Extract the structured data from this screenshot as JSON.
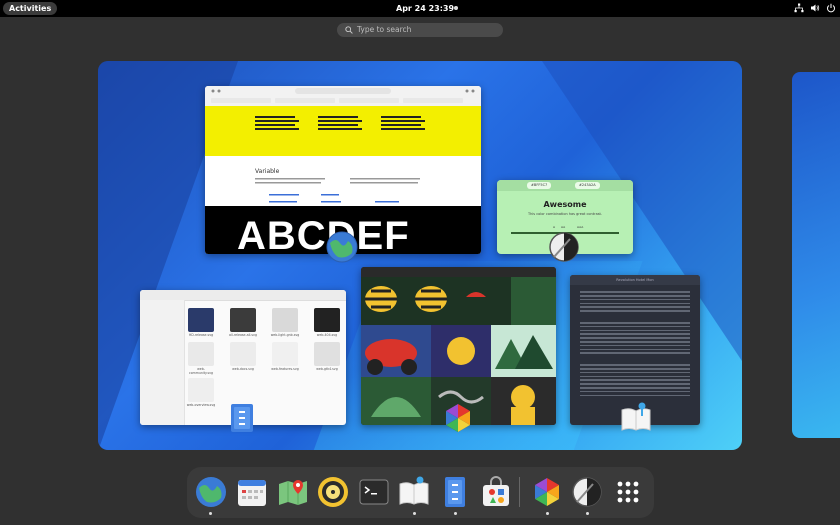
{
  "topbar": {
    "activities": "Activities",
    "clock": "Apr 24  23:39"
  },
  "search": {
    "placeholder": "Type to search"
  },
  "windows": {
    "browser": {
      "heading": "Variable",
      "big_text": "ABCDEF"
    },
    "contrast": {
      "color_a": "#BFF5C7",
      "color_b": "#243A2A",
      "title": "Awesome",
      "subtitle": "This color combination has great contrast.",
      "scale_labels": [
        "A",
        "AA",
        "AAA"
      ]
    },
    "files": {
      "thumbnails": [
        "HD-release.svg",
        "all-release-all.svg",
        "web-light-gnb.svg",
        "web-404.svg",
        "web-community.svg",
        "web-docs.svg",
        "web-features.svg",
        "web-gtk4.svg",
        "web-overview.svg"
      ]
    },
    "reader": {
      "title": "Revolution Hotel Mon"
    }
  },
  "dock": {
    "apps": [
      "web-browser",
      "calendar",
      "maps",
      "music",
      "terminal",
      "reader",
      "files",
      "software",
      "color-palette",
      "contrast",
      "app-grid"
    ]
  },
  "colors": {
    "topbar": "#000000",
    "overview_bg": "#303030",
    "dock_bg": "#3a3a3a",
    "contrast_bg": "#b7f0b4"
  }
}
